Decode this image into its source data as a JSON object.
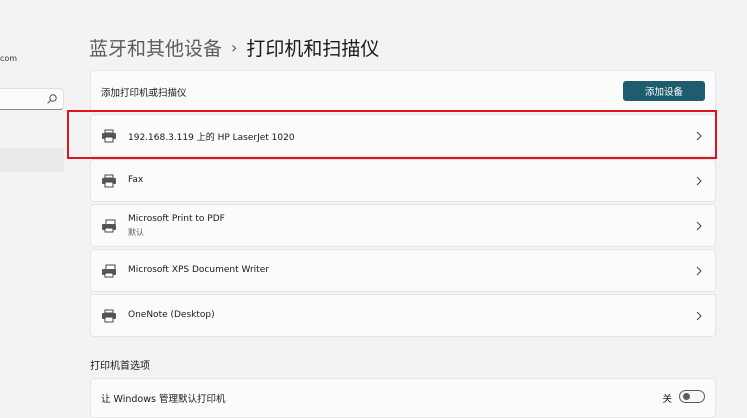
{
  "sidebar": {
    "account_fragment": "com",
    "search_value": "",
    "search_icon": "search-icon"
  },
  "breadcrumb": {
    "parent": "蓝牙和其他设备",
    "separator": "›",
    "current": "打印机和扫描仪"
  },
  "add_device": {
    "label": "添加打印机或扫描仪",
    "button_label": "添加设备"
  },
  "printers": [
    {
      "name": "192.168.3.119 上的 HP LaserJet 1020",
      "subtitle": "",
      "icon": "printer-icon",
      "highlighted": true
    },
    {
      "name": "Fax",
      "subtitle": "",
      "icon": "printer-icon"
    },
    {
      "name": "Microsoft Print to PDF",
      "subtitle": "默认",
      "icon": "printer-default-icon"
    },
    {
      "name": "Microsoft XPS Document Writer",
      "subtitle": "",
      "icon": "printer-default-icon"
    },
    {
      "name": "OneNote (Desktop)",
      "subtitle": "",
      "icon": "printer-icon"
    }
  ],
  "preferences": {
    "title": "打印机首选项",
    "setting_label": "让 Windows 管理默认打印机",
    "toggle_state": "关",
    "toggle_on": false
  },
  "colors": {
    "accent_button": "#1f5d6e",
    "highlight_border": "#e0141a"
  }
}
